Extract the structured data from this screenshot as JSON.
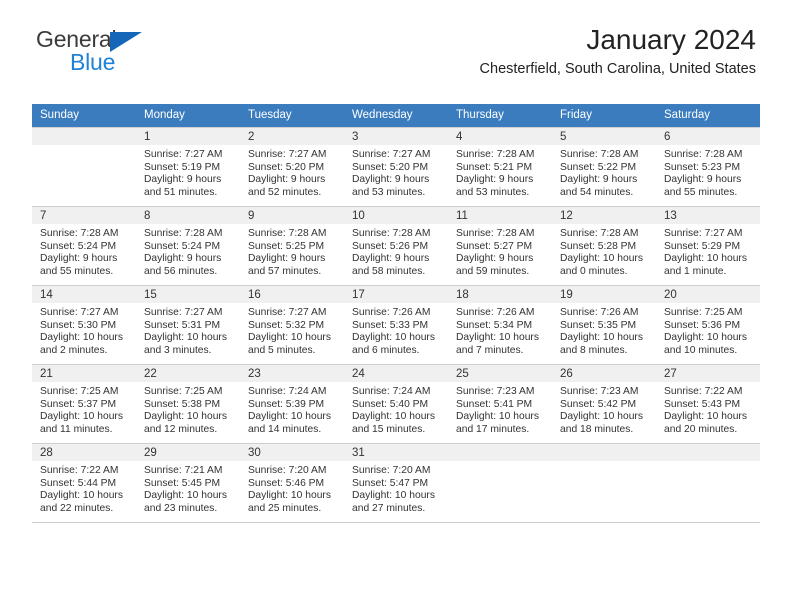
{
  "brand": {
    "name_part1": "General",
    "name_part2": "Blue",
    "accent_color": "#1f82d6",
    "triangle_color": "#1565b8"
  },
  "header": {
    "title": "January 2024",
    "subtitle": "Chesterfield, South Carolina, United States"
  },
  "calendar": {
    "header_bg": "#3a7cbe",
    "weekdays": [
      "Sunday",
      "Monday",
      "Tuesday",
      "Wednesday",
      "Thursday",
      "Friday",
      "Saturday"
    ],
    "weeks": [
      [
        {
          "day": "",
          "sunrise": "",
          "sunset": "",
          "daylight": "",
          "empty": true
        },
        {
          "day": "1",
          "sunrise": "Sunrise: 7:27 AM",
          "sunset": "Sunset: 5:19 PM",
          "daylight": "Daylight: 9 hours and 51 minutes."
        },
        {
          "day": "2",
          "sunrise": "Sunrise: 7:27 AM",
          "sunset": "Sunset: 5:20 PM",
          "daylight": "Daylight: 9 hours and 52 minutes."
        },
        {
          "day": "3",
          "sunrise": "Sunrise: 7:27 AM",
          "sunset": "Sunset: 5:20 PM",
          "daylight": "Daylight: 9 hours and 53 minutes."
        },
        {
          "day": "4",
          "sunrise": "Sunrise: 7:28 AM",
          "sunset": "Sunset: 5:21 PM",
          "daylight": "Daylight: 9 hours and 53 minutes."
        },
        {
          "day": "5",
          "sunrise": "Sunrise: 7:28 AM",
          "sunset": "Sunset: 5:22 PM",
          "daylight": "Daylight: 9 hours and 54 minutes."
        },
        {
          "day": "6",
          "sunrise": "Sunrise: 7:28 AM",
          "sunset": "Sunset: 5:23 PM",
          "daylight": "Daylight: 9 hours and 55 minutes."
        }
      ],
      [
        {
          "day": "7",
          "sunrise": "Sunrise: 7:28 AM",
          "sunset": "Sunset: 5:24 PM",
          "daylight": "Daylight: 9 hours and 55 minutes."
        },
        {
          "day": "8",
          "sunrise": "Sunrise: 7:28 AM",
          "sunset": "Sunset: 5:24 PM",
          "daylight": "Daylight: 9 hours and 56 minutes."
        },
        {
          "day": "9",
          "sunrise": "Sunrise: 7:28 AM",
          "sunset": "Sunset: 5:25 PM",
          "daylight": "Daylight: 9 hours and 57 minutes."
        },
        {
          "day": "10",
          "sunrise": "Sunrise: 7:28 AM",
          "sunset": "Sunset: 5:26 PM",
          "daylight": "Daylight: 9 hours and 58 minutes."
        },
        {
          "day": "11",
          "sunrise": "Sunrise: 7:28 AM",
          "sunset": "Sunset: 5:27 PM",
          "daylight": "Daylight: 9 hours and 59 minutes."
        },
        {
          "day": "12",
          "sunrise": "Sunrise: 7:28 AM",
          "sunset": "Sunset: 5:28 PM",
          "daylight": "Daylight: 10 hours and 0 minutes."
        },
        {
          "day": "13",
          "sunrise": "Sunrise: 7:27 AM",
          "sunset": "Sunset: 5:29 PM",
          "daylight": "Daylight: 10 hours and 1 minute."
        }
      ],
      [
        {
          "day": "14",
          "sunrise": "Sunrise: 7:27 AM",
          "sunset": "Sunset: 5:30 PM",
          "daylight": "Daylight: 10 hours and 2 minutes."
        },
        {
          "day": "15",
          "sunrise": "Sunrise: 7:27 AM",
          "sunset": "Sunset: 5:31 PM",
          "daylight": "Daylight: 10 hours and 3 minutes."
        },
        {
          "day": "16",
          "sunrise": "Sunrise: 7:27 AM",
          "sunset": "Sunset: 5:32 PM",
          "daylight": "Daylight: 10 hours and 5 minutes."
        },
        {
          "day": "17",
          "sunrise": "Sunrise: 7:26 AM",
          "sunset": "Sunset: 5:33 PM",
          "daylight": "Daylight: 10 hours and 6 minutes."
        },
        {
          "day": "18",
          "sunrise": "Sunrise: 7:26 AM",
          "sunset": "Sunset: 5:34 PM",
          "daylight": "Daylight: 10 hours and 7 minutes."
        },
        {
          "day": "19",
          "sunrise": "Sunrise: 7:26 AM",
          "sunset": "Sunset: 5:35 PM",
          "daylight": "Daylight: 10 hours and 8 minutes."
        },
        {
          "day": "20",
          "sunrise": "Sunrise: 7:25 AM",
          "sunset": "Sunset: 5:36 PM",
          "daylight": "Daylight: 10 hours and 10 minutes."
        }
      ],
      [
        {
          "day": "21",
          "sunrise": "Sunrise: 7:25 AM",
          "sunset": "Sunset: 5:37 PM",
          "daylight": "Daylight: 10 hours and 11 minutes."
        },
        {
          "day": "22",
          "sunrise": "Sunrise: 7:25 AM",
          "sunset": "Sunset: 5:38 PM",
          "daylight": "Daylight: 10 hours and 12 minutes."
        },
        {
          "day": "23",
          "sunrise": "Sunrise: 7:24 AM",
          "sunset": "Sunset: 5:39 PM",
          "daylight": "Daylight: 10 hours and 14 minutes."
        },
        {
          "day": "24",
          "sunrise": "Sunrise: 7:24 AM",
          "sunset": "Sunset: 5:40 PM",
          "daylight": "Daylight: 10 hours and 15 minutes."
        },
        {
          "day": "25",
          "sunrise": "Sunrise: 7:23 AM",
          "sunset": "Sunset: 5:41 PM",
          "daylight": "Daylight: 10 hours and 17 minutes."
        },
        {
          "day": "26",
          "sunrise": "Sunrise: 7:23 AM",
          "sunset": "Sunset: 5:42 PM",
          "daylight": "Daylight: 10 hours and 18 minutes."
        },
        {
          "day": "27",
          "sunrise": "Sunrise: 7:22 AM",
          "sunset": "Sunset: 5:43 PM",
          "daylight": "Daylight: 10 hours and 20 minutes."
        }
      ],
      [
        {
          "day": "28",
          "sunrise": "Sunrise: 7:22 AM",
          "sunset": "Sunset: 5:44 PM",
          "daylight": "Daylight: 10 hours and 22 minutes."
        },
        {
          "day": "29",
          "sunrise": "Sunrise: 7:21 AM",
          "sunset": "Sunset: 5:45 PM",
          "daylight": "Daylight: 10 hours and 23 minutes."
        },
        {
          "day": "30",
          "sunrise": "Sunrise: 7:20 AM",
          "sunset": "Sunset: 5:46 PM",
          "daylight": "Daylight: 10 hours and 25 minutes."
        },
        {
          "day": "31",
          "sunrise": "Sunrise: 7:20 AM",
          "sunset": "Sunset: 5:47 PM",
          "daylight": "Daylight: 10 hours and 27 minutes."
        },
        {
          "day": "",
          "sunrise": "",
          "sunset": "",
          "daylight": "",
          "empty": true
        },
        {
          "day": "",
          "sunrise": "",
          "sunset": "",
          "daylight": "",
          "empty": true
        },
        {
          "day": "",
          "sunrise": "",
          "sunset": "",
          "daylight": "",
          "empty": true
        }
      ]
    ]
  }
}
